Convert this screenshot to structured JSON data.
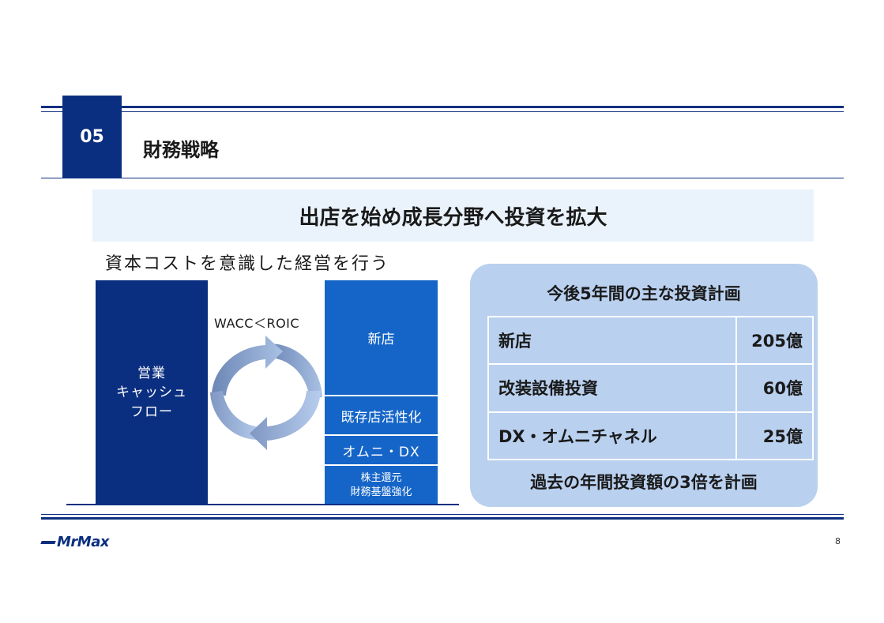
{
  "header": {
    "section_number": "05",
    "section_title": "財務戦略"
  },
  "headline": "出店を始め成長分野へ投資を拡大",
  "subheading": "資本コストを意識した経営を行う",
  "diagram": {
    "cashflow_label_lines": [
      "営業",
      "キャッシュ",
      "フロー"
    ],
    "relation_label": "WACC＜ROIC",
    "investments": {
      "new_store": "新店",
      "existing_store": "既存店活性化",
      "omni_dx": "オムニ・DX",
      "return_line1": "株主還元",
      "return_line2": "財務基盤強化"
    }
  },
  "plan": {
    "title": "今後5年間の主な投資計画",
    "rows": [
      {
        "item": "新店",
        "amount": "205億"
      },
      {
        "item": "改装設備投資",
        "amount": "60億"
      },
      {
        "item": "DX・オムニチャネル",
        "amount": "25億"
      }
    ],
    "footnote": "過去の年間投資額の3倍を計画"
  },
  "footer": {
    "logo_text": "MrMax",
    "page_number": "8"
  },
  "colors": {
    "navy": "#0b2f80",
    "blue": "#1565c8",
    "light_panel": "#b9d0ef",
    "banner": "#eaf3fb"
  }
}
